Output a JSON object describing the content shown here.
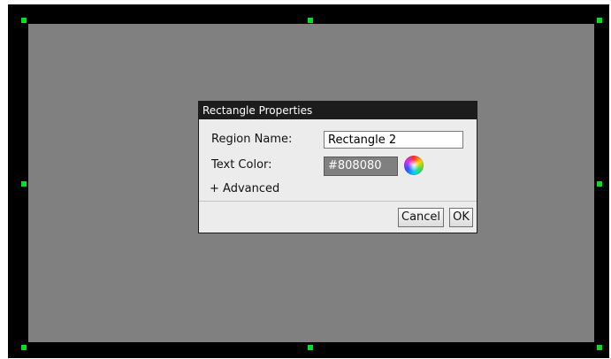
{
  "dialog": {
    "title": "Rectangle Properties",
    "region_name_label": "Region Name:",
    "region_name_value": "Rectangle 2",
    "text_color_label": "Text Color:",
    "text_color_value": "#808080",
    "advanced_toggle": "+ Advanced",
    "cancel_label": "Cancel",
    "ok_label": "OK"
  },
  "colors": {
    "canvas_background": "#808080",
    "frame": "#000000",
    "selection_handles": "#00e020",
    "titlebar": "#1c1c1c"
  },
  "icons": [
    "color-wheel-icon",
    "selection-handle"
  ]
}
